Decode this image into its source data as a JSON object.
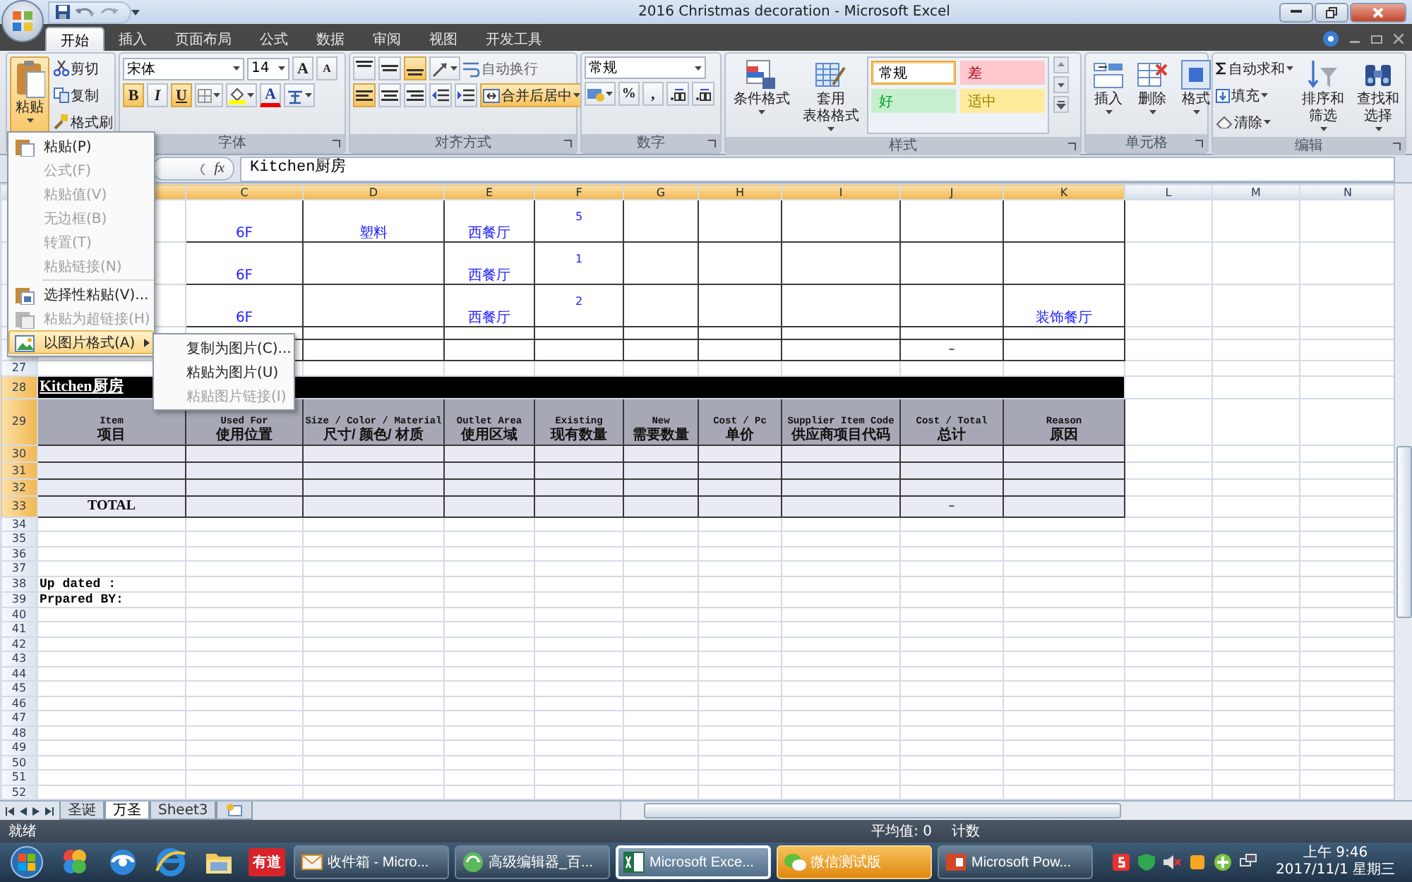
{
  "title_bar": {
    "title": "2016 Christmas decoration - Microsoft Excel"
  },
  "tabs": [
    {
      "label": "开始",
      "selected": true
    },
    {
      "label": "插入",
      "selected": false
    },
    {
      "label": "页面布局",
      "selected": false
    },
    {
      "label": "公式",
      "selected": false
    },
    {
      "label": "数据",
      "selected": false
    },
    {
      "label": "审阅",
      "selected": false
    },
    {
      "label": "视图",
      "selected": false
    },
    {
      "label": "开发工具",
      "selected": false
    }
  ],
  "clipboard": {
    "paste": "粘贴",
    "paste_open": true,
    "cut": "剪切",
    "copy": "复制",
    "format_painter": "格式刷"
  },
  "font": {
    "label": "字体",
    "name": "宋体",
    "size": "14",
    "grow": "A",
    "shrink": "A",
    "font_color": "A",
    "styles": [
      {
        "kind": "bold",
        "text": "B",
        "on": true
      },
      {
        "kind": "italic",
        "text": "I",
        "on": false
      },
      {
        "kind": "underline",
        "text": "U",
        "on": true
      }
    ]
  },
  "alignment": {
    "label": "对齐方式",
    "vertical": [
      {
        "kind": "top",
        "on": false
      },
      {
        "kind": "middle",
        "on": false
      },
      {
        "kind": "bottom",
        "on": true
      }
    ],
    "horizontal": [
      {
        "kind": "left",
        "on": true
      },
      {
        "kind": "center",
        "on": false
      },
      {
        "kind": "right",
        "on": false
      }
    ],
    "wrap_text": "自动换行",
    "merge_center": {
      "label": "合并后居中",
      "on": true
    }
  },
  "number": {
    "label": "数字",
    "format": "常规",
    "percent": "%",
    "comma": ","
  },
  "styles": {
    "label": "样式",
    "conditional": "条件格式",
    "table_format": [
      "套用",
      "表格格式"
    ],
    "cell_styles": [
      {
        "text": "常规",
        "color": "#ffffff",
        "selected": true
      },
      {
        "text": "差",
        "color": "#ffc7ce",
        "selected": false
      },
      {
        "text": "好",
        "color": "#c6efce",
        "selected": false
      },
      {
        "text": "适中",
        "color": "#ffeb9c",
        "selected": false
      }
    ]
  },
  "cells": {
    "label": "单元格",
    "buttons": [
      {
        "kind": "insert",
        "label": "插入"
      },
      {
        "kind": "delete",
        "label": "删除"
      },
      {
        "kind": "format",
        "label": "格式"
      }
    ]
  },
  "editing": {
    "label": "编辑",
    "autosum": "自动求和",
    "fill": "填充",
    "clear": "清除",
    "sort": [
      "排序和",
      "筛选"
    ],
    "find": [
      "查找和",
      "选择"
    ]
  },
  "formula_bar": {
    "fx": "fx",
    "value": "Kitchen厨房"
  },
  "paste_menu": {
    "sections": [
      [
        {
          "label": "粘贴(P)",
          "kind": "paste",
          "disabled": false,
          "selected": false
        },
        {
          "label": "公式(F)",
          "kind": "plain",
          "disabled": true,
          "selected": false
        },
        {
          "label": "粘贴值(V)",
          "kind": "plain",
          "disabled": true,
          "selected": false
        },
        {
          "label": "无边框(B)",
          "kind": "plain",
          "disabled": true,
          "selected": false
        },
        {
          "label": "转置(T)",
          "kind": "plain",
          "disabled": true,
          "selected": false
        },
        {
          "label": "粘贴链接(N)",
          "kind": "plain",
          "disabled": true,
          "selected": false
        }
      ],
      [
        {
          "label": "选择性粘贴(V)...",
          "kind": "special",
          "disabled": false,
          "selected": false
        },
        {
          "label": "粘贴为超链接(H)",
          "kind": "hyperlink",
          "disabled": true,
          "selected": false
        },
        {
          "label": "以图片格式(A)",
          "kind": "picture",
          "disabled": false,
          "selected": true,
          "submenu": [
            {
              "label": "复制为图片(C)...",
              "disabled": false,
              "selected": false
            },
            {
              "label": "粘贴为图片(U)",
              "disabled": false,
              "selected": false
            },
            {
              "label": "粘贴图片链接(I)",
              "disabled": true,
              "selected": false
            }
          ]
        }
      ]
    ]
  },
  "sheet": {
    "columns": [
      {
        "selected": true
      },
      {
        "label": "C",
        "selected": true
      },
      {
        "label": "D",
        "selected": true
      },
      {
        "label": "E",
        "selected": true
      },
      {
        "label": "F",
        "selected": true
      },
      {
        "label": "G",
        "selected": true
      },
      {
        "label": "H",
        "selected": true
      },
      {
        "label": "I",
        "selected": true
      },
      {
        "label": "J",
        "selected": true
      },
      {
        "label": "K",
        "selected": true
      },
      {
        "label": "L",
        "selected": false
      },
      {
        "label": "M",
        "selected": false
      },
      {
        "label": "N",
        "selected": false
      }
    ],
    "rows": [
      {
        "kind": "data",
        "cells": {
          "C": "6F",
          "D": "塑料",
          "E": "西餐厅",
          "F": "5"
        }
      },
      {
        "kind": "data",
        "cells": {
          "C": "6F",
          "E": "西餐厅",
          "F": "1"
        }
      },
      {
        "kind": "data",
        "cells": {
          "C": "6F",
          "E": "西餐厅",
          "F": "2",
          "K": "装饰餐厅"
        }
      },
      {
        "kind": "spacer"
      },
      {
        "kind": "subtotal",
        "cells": {
          "J": "–"
        }
      },
      {
        "number": "27",
        "kind": "empty",
        "selected": false
      },
      {
        "number": "28",
        "kind": "title",
        "selected": true,
        "title": "Kitchen厨房"
      },
      {
        "number": "29",
        "kind": "header",
        "selected": true,
        "headers": [
          {
            "en": "Item",
            "zh": "项目"
          },
          {
            "en": "Used For",
            "zh": "使用位置"
          },
          {
            "en": "Size  / Color / Material",
            "zh": "尺寸/ 颜色/ 材质"
          },
          {
            "en": "Outlet Area",
            "zh": "使用区域"
          },
          {
            "en": "Existing",
            "zh": "现有数量"
          },
          {
            "en": "New",
            "zh": "需要数量"
          },
          {
            "en": "Cost / Pc",
            "zh": "单价"
          },
          {
            "en": "Supplier Item Code",
            "zh": "供应商项目代码"
          },
          {
            "en": "Cost / Total",
            "zh": "总计"
          },
          {
            "en": "Reason",
            "zh": "原因"
          }
        ]
      },
      {
        "number": "30",
        "kind": "body",
        "selected": true
      },
      {
        "number": "31",
        "kind": "body",
        "selected": true
      },
      {
        "number": "32",
        "kind": "body",
        "selected": true
      },
      {
        "number": "33",
        "kind": "total",
        "selected": true,
        "label": "TOTAL",
        "cells": {
          "J": "–"
        }
      },
      {
        "number": "34",
        "kind": "empty",
        "selected": false
      },
      {
        "number": "35",
        "kind": "empty",
        "selected": false
      },
      {
        "number": "36",
        "kind": "empty",
        "selected": false
      },
      {
        "number": "37",
        "kind": "empty",
        "selected": false
      },
      {
        "number": "38",
        "kind": "note",
        "selected": false,
        "label": "Up dated :"
      },
      {
        "number": "39",
        "kind": "note",
        "selected": false,
        "label": "Prpared BY:"
      },
      {
        "number": "40",
        "kind": "empty",
        "selected": false
      },
      {
        "number": "41",
        "kind": "empty",
        "selected": false
      },
      {
        "number": "42",
        "kind": "empty",
        "selected": false
      },
      {
        "number": "43",
        "kind": "empty",
        "selected": false
      },
      {
        "number": "44",
        "kind": "empty",
        "selected": false
      },
      {
        "number": "45",
        "kind": "empty",
        "selected": false
      },
      {
        "number": "46",
        "kind": "empty",
        "selected": false
      },
      {
        "number": "47",
        "kind": "empty",
        "selected": false
      },
      {
        "number": "48",
        "kind": "empty",
        "selected": false
      },
      {
        "number": "49",
        "kind": "empty",
        "selected": false
      },
      {
        "number": "50",
        "kind": "empty",
        "selected": false
      },
      {
        "number": "51",
        "kind": "empty",
        "selected": false
      },
      {
        "number": "52",
        "kind": "empty",
        "selected": false
      }
    ]
  },
  "sheet_tabs": [
    {
      "label": "圣诞",
      "selected": false
    },
    {
      "label": "万圣",
      "selected": true
    },
    {
      "label": "Sheet3",
      "selected": false
    }
  ],
  "status_bar": {
    "mode": "就绪",
    "average": "平均值: 0",
    "count": "计数"
  },
  "taskbar": {
    "pinned": [
      {
        "kind": "flower"
      },
      {
        "kind": "globe"
      },
      {
        "kind": "browser"
      },
      {
        "kind": "folder"
      },
      {
        "kind": "badge",
        "label": "有道"
      }
    ],
    "buttons": [
      {
        "label": "收件箱 - Micro...",
        "kind": "mail",
        "selected": false,
        "attention": false
      },
      {
        "label": "高级编辑器_百...",
        "kind": "editor",
        "selected": false,
        "attention": false
      },
      {
        "label": "Microsoft Exce...",
        "kind": "excel",
        "selected": true,
        "attention": false
      },
      {
        "label": "微信测试版",
        "kind": "chat",
        "selected": false,
        "attention": true
      },
      {
        "label": "Microsoft Pow...",
        "kind": "slides",
        "selected": false,
        "attention": false
      }
    ],
    "clock": {
      "time": "上午 9:46",
      "date": "2017/11/1 星期三"
    }
  }
}
